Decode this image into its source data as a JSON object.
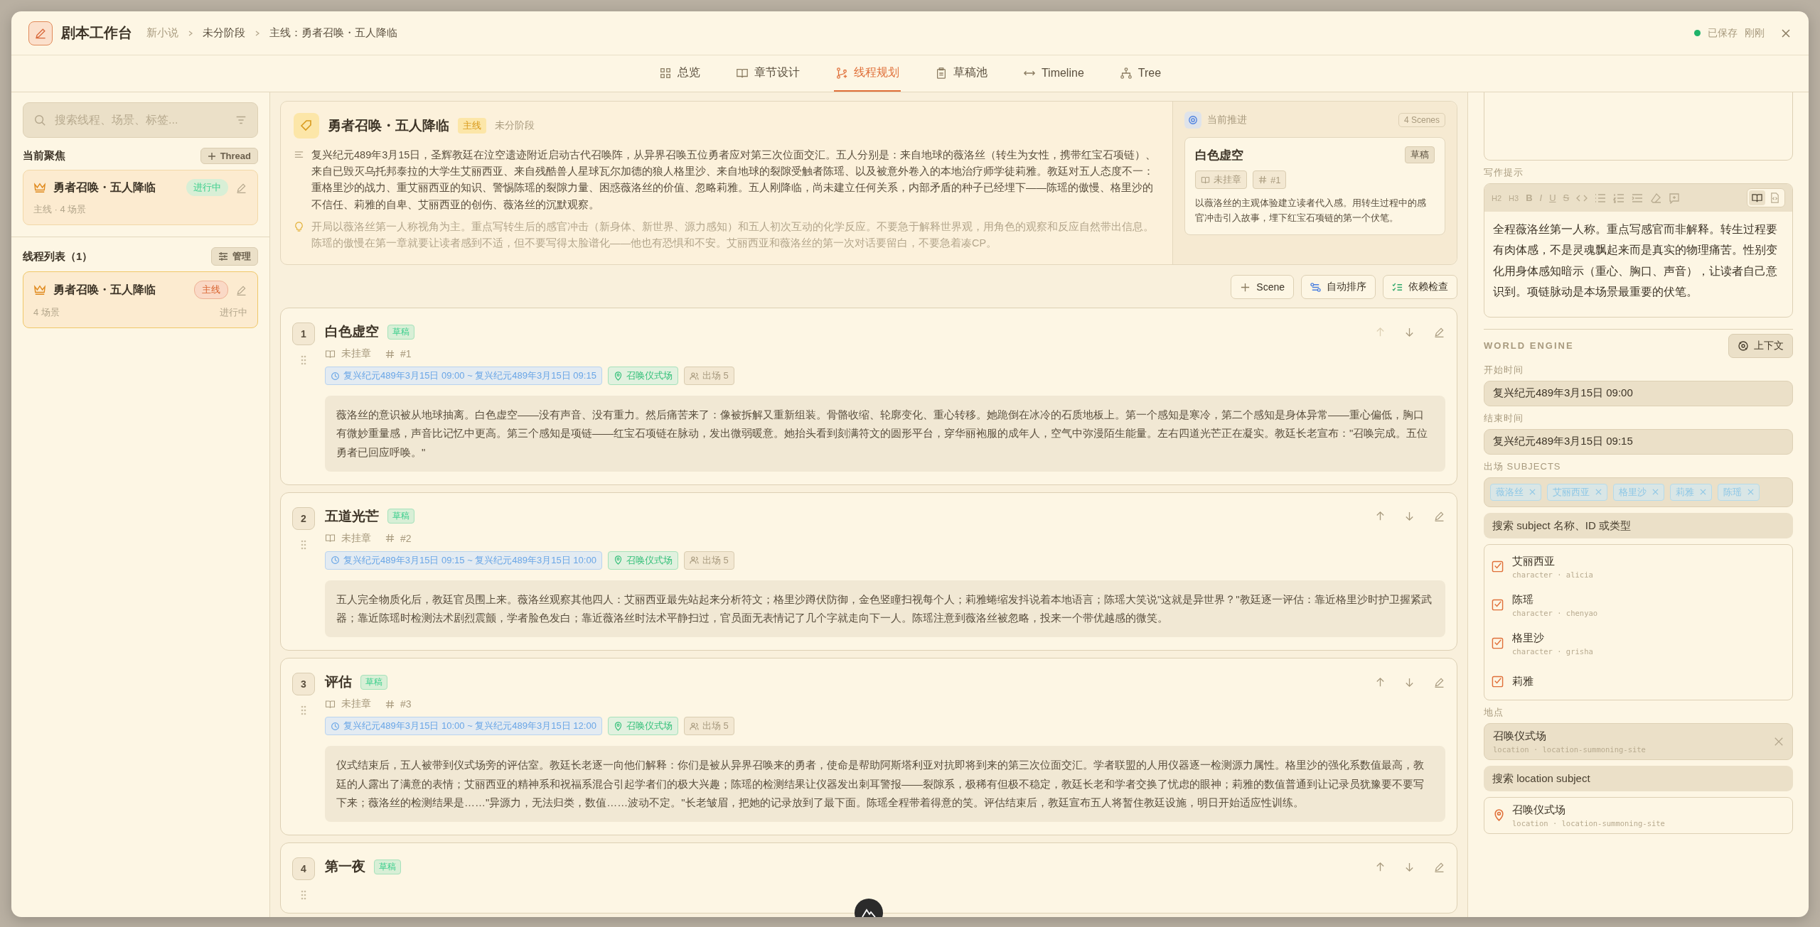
{
  "app": {
    "title": "剧本工作台",
    "breadcrumb": [
      "新小说",
      "未分阶段",
      "主线：勇者召唤・五人降临"
    ],
    "save_status": "已保存",
    "save_time": "刚刚"
  },
  "tabs": [
    {
      "label": "总览",
      "kind": "grid",
      "selected": false
    },
    {
      "label": "章节设计",
      "kind": "book",
      "selected": false
    },
    {
      "label": "线程规划",
      "kind": "branch",
      "selected": true
    },
    {
      "label": "草稿池",
      "kind": "clipboard",
      "selected": false
    },
    {
      "label": "Timeline",
      "kind": "arrows",
      "selected": false
    },
    {
      "label": "Tree",
      "kind": "tree",
      "selected": false
    }
  ],
  "sidebar": {
    "search_placeholder": "搜索线程、场景、标签...",
    "focus_title": "当前聚焦",
    "add_thread": "Thread",
    "focus_thread": {
      "title": "勇者召唤・五人降临",
      "status": "进行中",
      "meta": "主线 · 4 场景"
    },
    "list_title": "线程列表（1）",
    "manage": "管理",
    "threads": [
      {
        "title": "勇者召唤・五人降临",
        "tag": "主线",
        "scenes": "4 场景",
        "status": "进行中",
        "selected": true
      }
    ]
  },
  "thread": {
    "title": "勇者召唤・五人降临",
    "tag": "主线",
    "stage": "未分阶段",
    "summary": "复兴纪元489年3月15日，圣辉教廷在泣空遗迹附近启动古代召唤阵，从异界召唤五位勇者应对第三次位面交汇。五人分别是：来自地球的薇洛丝（转生为女性，携带红宝石项链）、来自已毁灭乌托邦泰拉的大学生艾丽西亚、来自残酷兽人星球瓦尔加德的狼人格里沙、来自地球的裂隙受触者陈瑶、以及被意外卷入的本地治疗师学徒莉雅。教廷对五人态度不一：重格里沙的战力、重艾丽西亚的知识、警惕陈瑶的裂隙力量、困惑薇洛丝的价值、忽略莉雅。五人刚降临，尚未建立任何关系，内部矛盾的种子已经埋下——陈瑶的傲慢、格里沙的不信任、莉雅的自卑、艾丽西亚的创伤、薇洛丝的沉默观察。",
    "hint": "开局以薇洛丝第一人称视角为主。重点写转生后的感官冲击（新身体、新世界、源力感知）和五人初次互动的化学反应。不要急于解释世界观，用角色的观察和反应自然带出信息。陈瑶的傲慢在第一章就要让读者感到不适，但不要写得太脸谱化——他也有恐惧和不安。艾丽西亚和薇洛丝的第一次对话要留白，不要急着凑CP。",
    "current": {
      "label": "当前推进",
      "count": "4 Scenes",
      "scene_title": "白色虚空",
      "status": "草稿",
      "chapter": "未挂章",
      "number": "#1",
      "description": "以薇洛丝的主观体验建立读者代入感。用转生过程中的感官冲击引入故事，埋下红宝石项链的第一个伏笔。"
    }
  },
  "actions": [
    {
      "kind": "plus",
      "label": "Scene"
    },
    {
      "kind": "sort",
      "label": "自动排序"
    },
    {
      "kind": "check",
      "label": "依赖检查"
    }
  ],
  "scenes": [
    {
      "number": "1",
      "title": "白色虚空",
      "status": "草稿",
      "can_move_up": false,
      "chapter": "未挂章",
      "index": "#1",
      "time": "复兴纪元489年3月15日 09:00 ~ 复兴纪元489年3月15日 09:15",
      "location": "召唤仪式场",
      "cast": "出场 5",
      "text": "薇洛丝的意识被从地球抽离。白色虚空——没有声音、没有重力。然后痛苦来了：像被拆解又重新组装。骨骼收缩、轮廓变化、重心转移。她跪倒在冰冷的石质地板上。第一个感知是寒冷，第二个感知是身体异常——重心偏低，胸口有微妙重量感，声音比记忆中更高。第三个感知是项链——红宝石项链在脉动，发出微弱暖意。她抬头看到刻满符文的圆形平台，穿华丽袍服的成年人，空气中弥漫陌生能量。左右四道光芒正在凝实。教廷长老宣布：\"召唤完成。五位勇者已回应呼唤。\""
    },
    {
      "number": "2",
      "title": "五道光芒",
      "status": "草稿",
      "can_move_up": true,
      "chapter": "未挂章",
      "index": "#2",
      "time": "复兴纪元489年3月15日 09:15 ~ 复兴纪元489年3月15日 10:00",
      "location": "召唤仪式场",
      "cast": "出场 5",
      "text": "五人完全物质化后，教廷官员围上来。薇洛丝观察其他四人：艾丽西亚最先站起来分析符文；格里沙蹲伏防御，金色竖瞳扫视每个人；莉雅蜷缩发抖说着本地语言；陈瑶大笑说\"这就是异世界？\"教廷逐一评估：靠近格里沙时护卫握紧武器；靠近陈瑶时检测法术剧烈震颤，学者脸色发白；靠近薇洛丝时法术平静扫过，官员面无表情记了几个字就走向下一人。陈瑶注意到薇洛丝被忽略，投来一个带优越感的微笑。"
    },
    {
      "number": "3",
      "title": "评估",
      "status": "草稿",
      "can_move_up": true,
      "chapter": "未挂章",
      "index": "#3",
      "time": "复兴纪元489年3月15日 10:00 ~ 复兴纪元489年3月15日 12:00",
      "location": "召唤仪式场",
      "cast": "出场 5",
      "text": "仪式结束后，五人被带到仪式场旁的评估室。教廷长老逐一向他们解释：你们是被从异界召唤来的勇者，使命是帮助阿斯塔利亚对抗即将到来的第三次位面交汇。学者联盟的人用仪器逐一检测源力属性。格里沙的强化系数值最高，教廷的人露出了满意的表情；艾丽西亚的精神系和祝福系混合引起学者们的极大兴趣；陈瑶的检测结果让仪器发出刺耳警报——裂隙系，极稀有但极不稳定，教廷长老和学者交换了忧虑的眼神；莉雅的数值普通到让记录员犹豫要不要写下来；薇洛丝的检测结果是……\"异源力，无法归类，数值……波动不定。\"长老皱眉，把她的记录放到了最下面。陈瑶全程带着得意的笑。评估结束后，教廷宣布五人将暂住教廷设施，明日开始适应性训练。"
    },
    {
      "number": "4",
      "title": "第一夜",
      "status": "草稿",
      "can_move_up": true
    }
  ],
  "editor": {
    "writing_hint_label": "写作提示",
    "toolbar": [
      {
        "kind": "h2",
        "glyph": "H2"
      },
      {
        "kind": "h3",
        "glyph": "H3"
      },
      {
        "kind": "bold",
        "glyph": "B"
      },
      {
        "kind": "italic",
        "glyph": "I"
      },
      {
        "kind": "underline",
        "glyph": "U"
      },
      {
        "kind": "strike",
        "glyph": "S"
      },
      {
        "kind": "code"
      },
      {
        "kind": "bullets"
      },
      {
        "kind": "numbers"
      },
      {
        "kind": "indent"
      },
      {
        "kind": "eraser"
      },
      {
        "kind": "comment"
      }
    ],
    "view_modes": [
      {
        "kind": "read",
        "selected": true
      },
      {
        "kind": "source",
        "selected": false
      }
    ],
    "writing_hint": "全程薇洛丝第一人称。重点写感官而非解释。转生过程要有肉体感，不是灵魂飘起来而是真实的物理痛苦。性别变化用身体感知暗示（重心、胸口、声音），让读者自己意识到。项链脉动是本场景最重要的伏笔。"
  },
  "world": {
    "title": "WORLD ENGINE",
    "context_button": "上下文",
    "start_label": "开始时间",
    "start": "复兴纪元489年3月15日 09:00",
    "end_label": "结束时间",
    "end": "复兴纪元489年3月15日 09:15",
    "subjects_label": "出场 SUBJECTS",
    "subject_tags": [
      "薇洛丝",
      "艾丽西亚",
      "格里沙",
      "莉雅",
      "陈瑶"
    ],
    "subject_search": {
      "placeholder": "搜索 subject 名称、ID 或类型"
    },
    "subject_options": [
      {
        "name": "艾丽西亚",
        "meta": "character · alicia",
        "checked": true
      },
      {
        "name": "陈瑶",
        "meta": "character · chenyao",
        "checked": true
      },
      {
        "name": "格里沙",
        "meta": "character · grisha",
        "checked": true
      },
      {
        "name": "莉雅",
        "checked": true
      }
    ],
    "location_label": "地点",
    "location": {
      "name": "召唤仪式场",
      "meta": "location · location-summoning-site"
    },
    "location_search": {
      "placeholder": "搜索 location subject"
    },
    "location_options": [
      {
        "name": "召唤仪式场",
        "meta": "location · location-summoning-site"
      }
    ]
  }
}
